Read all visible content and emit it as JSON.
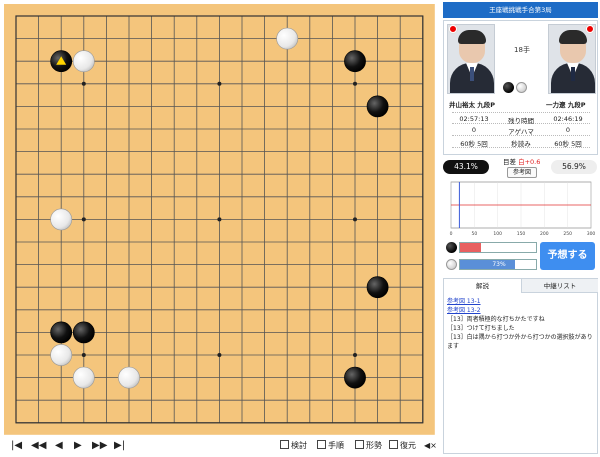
{
  "game": {
    "title": "王座戦挑戦手合第3局",
    "move_number": "18手",
    "board_size": 19,
    "last_move_marker": "triangle",
    "stones": [
      {
        "color": "black",
        "col": "C",
        "row": 17,
        "last": true
      },
      {
        "color": "white",
        "col": "D",
        "row": 17
      },
      {
        "color": "white",
        "col": "N",
        "row": 18
      },
      {
        "color": "black",
        "col": "Q",
        "row": 17
      },
      {
        "color": "black",
        "col": "R",
        "row": 15
      },
      {
        "color": "white",
        "col": "C",
        "row": 10
      },
      {
        "color": "black",
        "col": "R",
        "row": 7
      },
      {
        "color": "black",
        "col": "C",
        "row": 5
      },
      {
        "color": "black",
        "col": "D",
        "row": 5
      },
      {
        "color": "white",
        "col": "C",
        "row": 4
      },
      {
        "color": "white",
        "col": "D",
        "row": 3
      },
      {
        "color": "white",
        "col": "F",
        "row": 3
      },
      {
        "color": "black",
        "col": "Q",
        "row": 3
      }
    ]
  },
  "players": {
    "black": {
      "name": "井山裕太 九段P",
      "time_left": "02:57:13",
      "agehama": "0",
      "byoyomi": "60秒 5回",
      "flag": "japan-flag-icon"
    },
    "white": {
      "name": "一力遼 九段P",
      "time_left": "02:46:19",
      "agehama": "0",
      "byoyomi": "60秒 5回",
      "flag": "japan-flag-icon"
    }
  },
  "stats_labels": {
    "time": "残り時間",
    "agehama": "アゲハマ",
    "byoyomi": "秒読み"
  },
  "winrate": {
    "black": "43.1%",
    "white": "56.9%",
    "moku_label": "目差",
    "moku_value": "白+0.6",
    "ref_button": "参考図"
  },
  "graph": {
    "x_ticks": [
      "0",
      "50",
      "100",
      "150",
      "200",
      "250",
      "300"
    ],
    "marker_move": 18
  },
  "prediction": {
    "black_pct": 27,
    "white_pct": 73,
    "black_label": "27%",
    "white_label": "73%",
    "button": "予想する"
  },
  "comments": {
    "tab_active": "解説",
    "tab_other": "中継リスト",
    "links": [
      "参考図 13-1",
      "参考図 13-2"
    ],
    "lines": [
      "［13］両者積極的な打ちかたですね",
      "［13］つけて打ちました",
      "［13］白は隅から打つか外から打つかの選択肢があります"
    ]
  },
  "controls": {
    "first": "|◀",
    "back10": "◀◀",
    "back": "◀",
    "forward": "▶",
    "forward10": "▶▶",
    "last": "▶|",
    "review": "検討",
    "order": "手順",
    "shape": "形勢",
    "restore": "復元",
    "sound": "◀×"
  },
  "colors": {
    "board": "#f4c57c",
    "grid": "#555555",
    "accent": "#1e6cc6",
    "winrate_line": "#e03030",
    "black_bar": "#e86060",
    "white_bar": "#5a8fd8"
  }
}
